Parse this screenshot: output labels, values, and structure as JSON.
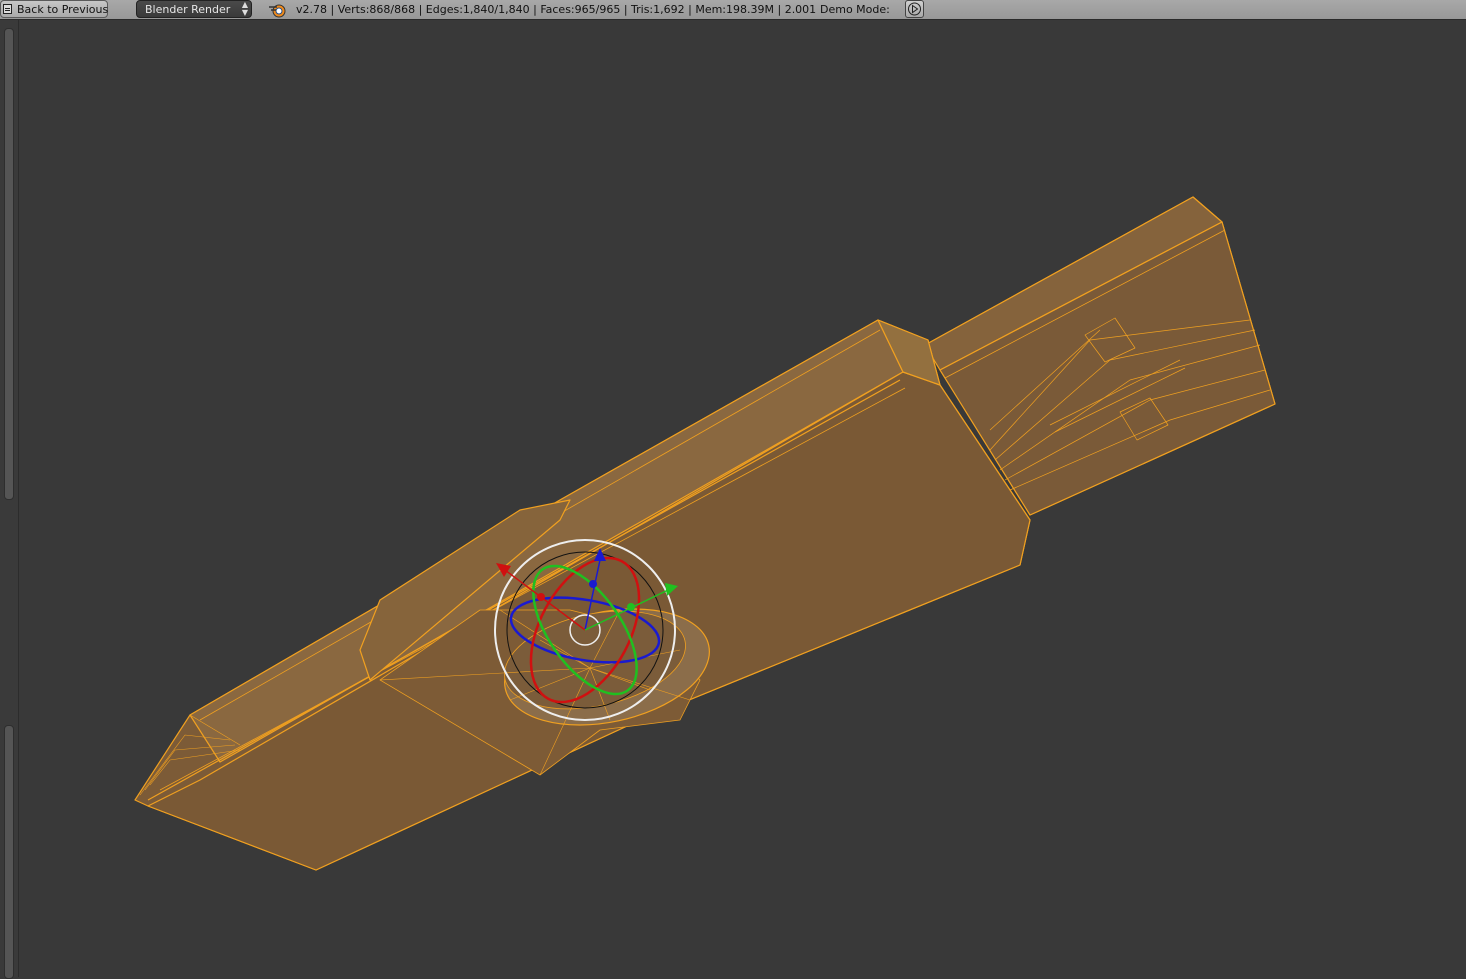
{
  "header": {
    "back_button": "Back to Previous",
    "render_engine": "Blender Render",
    "stats": "v2.78 | Verts:868/868 | Edges:1,840/1,840 | Faces:965/965 | Tris:1,692 | Mem:198.39M | 2.001",
    "demo_mode_label": "Demo Mode:"
  },
  "icons": {
    "back": "back-icon",
    "engine_dropdown": "dropdown-arrows-icon",
    "logo": "blender-logo-icon",
    "play": "play-icon"
  },
  "colors": {
    "background": "#393939",
    "header": "#9f9f9f",
    "mesh_fill": "#7a5a38",
    "wire_selected": "#f0a020",
    "gizmo_x": "#d01010",
    "gizmo_y": "#20c020",
    "gizmo_z": "#1a1ad0",
    "gizmo_view": "#e8e8e8"
  }
}
